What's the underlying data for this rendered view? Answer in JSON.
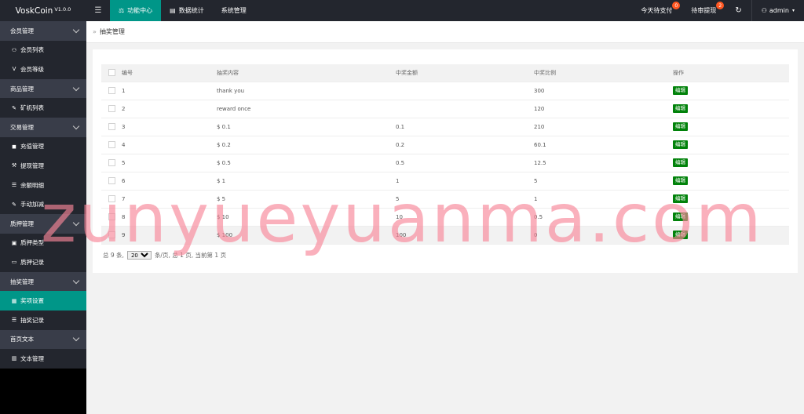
{
  "header": {
    "logo": "VoskCoin",
    "version": "V1.0.0",
    "menu_icon": "☰",
    "nav": [
      {
        "label": "功能中心",
        "icon": "scale-icon"
      },
      {
        "label": "数据统计",
        "icon": "database-icon"
      },
      {
        "label": "系统管理",
        "icon": ""
      }
    ],
    "right": {
      "pending_pay": {
        "label": "今天待支付",
        "badge": "0"
      },
      "pending_withdraw": {
        "label": "待审提现",
        "badge": "2"
      },
      "refresh_icon": "refresh-icon",
      "user": "admin"
    }
  },
  "sidebar": {
    "groups": [
      {
        "label": "会员管理",
        "items": [
          {
            "label": "会员列表",
            "icon": "user-icon"
          },
          {
            "label": "会员等级",
            "icon": "vip-icon"
          }
        ]
      },
      {
        "label": "商品管理",
        "items": [
          {
            "label": "矿机列表",
            "icon": "edit-icon"
          }
        ]
      },
      {
        "label": "交易管理",
        "items": [
          {
            "label": "充值管理",
            "icon": "cube-icon"
          },
          {
            "label": "提现管理",
            "icon": "hammer-icon"
          },
          {
            "label": "余额明细",
            "icon": "list-icon"
          },
          {
            "label": "手动加减",
            "icon": "edit-icon"
          }
        ]
      },
      {
        "label": "质押管理",
        "items": [
          {
            "label": "质押类型",
            "icon": "doc-icon"
          },
          {
            "label": "质押记录",
            "icon": "card-icon"
          }
        ]
      },
      {
        "label": "抽奖管理",
        "items": [
          {
            "label": "奖项设置",
            "icon": "grid-icon",
            "active": true
          },
          {
            "label": "抽奖记录",
            "icon": "list-icon"
          }
        ]
      },
      {
        "label": "首页文本",
        "items": [
          {
            "label": "文本管理",
            "icon": "book-icon"
          }
        ]
      }
    ]
  },
  "breadcrumb": {
    "title": "抽奖管理"
  },
  "table": {
    "columns": [
      "编号",
      "抽奖内容",
      "中奖金额",
      "中奖比例",
      "操作"
    ],
    "rows": [
      {
        "id": "1",
        "content": "thank you",
        "amount": "",
        "ratio": "300"
      },
      {
        "id": "2",
        "content": "reward once",
        "amount": "",
        "ratio": "120"
      },
      {
        "id": "3",
        "content": "$ 0.1",
        "amount": "0.1",
        "ratio": "210"
      },
      {
        "id": "4",
        "content": "$ 0.2",
        "amount": "0.2",
        "ratio": "60.1"
      },
      {
        "id": "5",
        "content": "$ 0.5",
        "amount": "0.5",
        "ratio": "12.5"
      },
      {
        "id": "6",
        "content": "$ 1",
        "amount": "1",
        "ratio": "5"
      },
      {
        "id": "7",
        "content": "$ 5",
        "amount": "5",
        "ratio": "1"
      },
      {
        "id": "8",
        "content": "$ 10",
        "amount": "10",
        "ratio": "0.5"
      },
      {
        "id": "9",
        "content": "$ 100",
        "amount": "100",
        "ratio": "0"
      }
    ],
    "edit_label": "编辑"
  },
  "pagination": {
    "total_text": "总 9 条,",
    "per_page": "20",
    "suffix": "条/页, 总 1 页, 当前第 1 页"
  },
  "watermark": "zunyueyuanma.com"
}
